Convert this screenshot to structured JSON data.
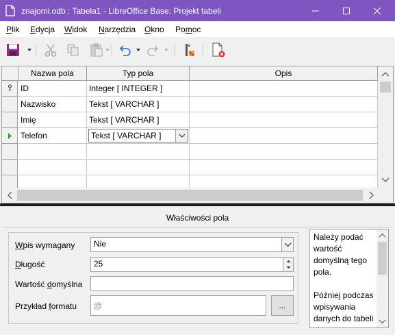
{
  "window": {
    "title": "znajomi.odb : Tabela1 - LibreOffice Base: Projekt tabeli",
    "accent": "#7e55c1"
  },
  "menu": [
    {
      "pre": "",
      "key": "P",
      "rest": "lik"
    },
    {
      "pre": "",
      "key": "E",
      "rest": "dycja"
    },
    {
      "pre": "",
      "key": "W",
      "rest": "idok"
    },
    {
      "pre": "",
      "key": "N",
      "rest": "arzędzia"
    },
    {
      "pre": "",
      "key": "O",
      "rest": "kno"
    },
    {
      "pre": "Po",
      "key": "m",
      "rest": "oc"
    }
  ],
  "toolbar": {
    "icons": [
      "save-icon",
      "cut-icon",
      "copy-icon",
      "paste-icon",
      "undo-icon",
      "redo-icon",
      "primary-key-icon",
      "index-design-icon"
    ]
  },
  "grid": {
    "columns": [
      "Nazwa pola",
      "Typ pola",
      "Opis"
    ],
    "rows": [
      {
        "name": "ID",
        "type": "Integer [ INTEGER ]",
        "desc": "",
        "marker": "key-icon"
      },
      {
        "name": "Nazwisko",
        "type": "Tekst [ VARCHAR ]",
        "desc": "",
        "marker": ""
      },
      {
        "name": "Imię",
        "type": "Tekst [ VARCHAR ]",
        "desc": "",
        "marker": ""
      },
      {
        "name": "Telefon",
        "type": "Tekst [ VARCHAR ]",
        "desc": "",
        "marker": "current-row-arrow-icon"
      },
      {
        "name": "",
        "type": "",
        "desc": "",
        "marker": ""
      },
      {
        "name": "",
        "type": "",
        "desc": "",
        "marker": ""
      },
      {
        "name": "",
        "type": "",
        "desc": "",
        "marker": ""
      }
    ]
  },
  "properties": {
    "title": "Właściwości pola",
    "required": {
      "label_key": "W",
      "label_rest": "pis wymagany",
      "value": "Nie"
    },
    "length": {
      "label_key": "D",
      "label_rest": "ługość",
      "value": "25"
    },
    "default": {
      "label_pre": "Wartość ",
      "label_key": "d",
      "label_rest": "omyślna",
      "value": ""
    },
    "format": {
      "label_pre": "Przykład ",
      "label_key": "f",
      "label_rest": "ormatu",
      "value": "@",
      "button_label": "..."
    },
    "help_text": "Należy podać wartość domyślną tego pola.\n\nPóźniej podczas wpisywania danych do tabeli ciąg ten"
  }
}
